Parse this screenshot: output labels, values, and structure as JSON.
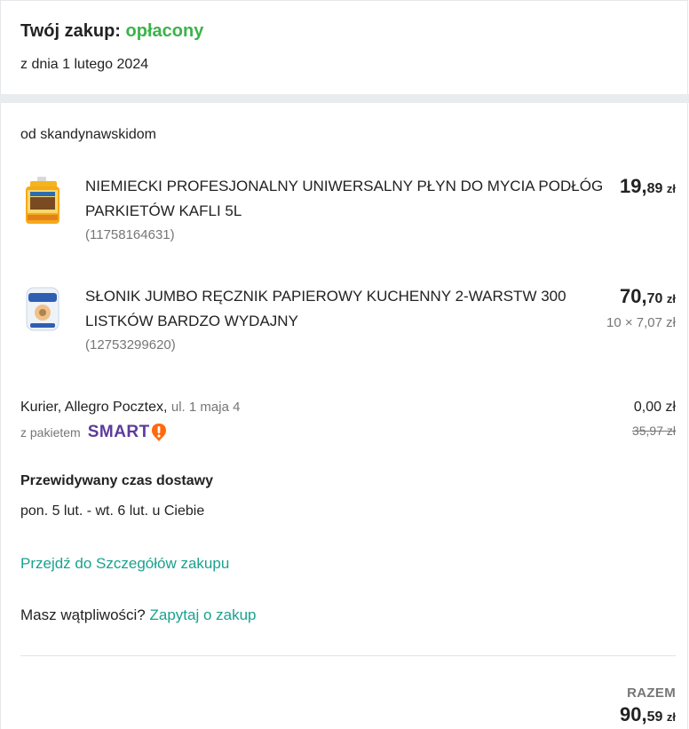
{
  "header": {
    "title_prefix": "Twój zakup:",
    "status": "opłacony",
    "date": "z dnia 1 lutego 2024"
  },
  "order": {
    "seller": "od skandynawskidom",
    "items": [
      {
        "name": "NIEMIECKI PROFESJONALNY UNIWERSALNY PŁYN DO MYCIA PODŁÓG PARKIETÓW KAFLI 5L",
        "id": "(11758164631)",
        "price_main": "19,",
        "price_cents": "89",
        "currency": "zł",
        "unit_price": ""
      },
      {
        "name": "SŁONIK JUMBO RĘCZNIK PAPIEROWY KUCHENNY 2-WARSTW 300 LISTKÓW BARDZO WYDAJNY",
        "id": "(12753299620)",
        "price_main": "70,",
        "price_cents": "70",
        "currency": "zł",
        "unit_price": "10 × 7,07 zł"
      }
    ],
    "delivery": {
      "method": "Kurier, Allegro Pocztex,",
      "address": "ul. 1 maja 4",
      "package_label": "z pakietem",
      "package_brand": "SMART",
      "price": "0,00 zł",
      "old_price": "35,97 zł"
    },
    "eta": {
      "heading": "Przewidywany czas dostawy",
      "text": "pon. 5 lut. - wt. 6 lut. u Ciebie"
    },
    "details_link": "Przejdź do Szczegółów zakupu",
    "question": {
      "text": "Masz wątpliwości?",
      "link": "Zapytaj o zakup"
    },
    "total": {
      "label": "RAZEM",
      "main": "90,",
      "cents": "59",
      "currency": "zł"
    }
  },
  "colors": {
    "status_green": "#3bb34a",
    "link_teal": "#1aa18f",
    "smart_purple": "#5b3c9a",
    "smart_orange": "#ff6a0e"
  }
}
